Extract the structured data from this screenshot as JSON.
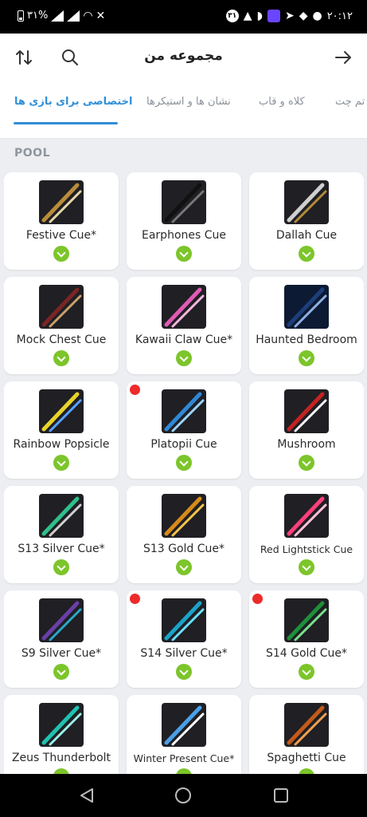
{
  "status_bar": {
    "battery_text": "۳۱%",
    "time": "۲۰:۱۲",
    "notification_count": "۳۱"
  },
  "header": {
    "title": "مجموعه من",
    "sort_icon": "sort-arrows-icon",
    "search_icon": "search-icon",
    "back_icon": "arrow-right-icon"
  },
  "tabs": [
    {
      "label": "اختصاصی برای بازی ها",
      "active": true
    },
    {
      "label": "نشان ها و استیکرها",
      "active": false
    },
    {
      "label": "کلاه و قاب",
      "active": false
    },
    {
      "label": "تم چت",
      "active": false
    }
  ],
  "section": {
    "label": "POOL"
  },
  "items": [
    {
      "name": "Festive Cue*",
      "new": false,
      "thumb_colors": [
        "#1f1f24",
        "#b98c3a",
        "#e7d7a8"
      ]
    },
    {
      "name": "Earphones Cue",
      "new": false,
      "thumb_colors": [
        "#1f1f24",
        "#111111",
        "#777777"
      ]
    },
    {
      "name": "Dallah Cue",
      "new": false,
      "thumb_colors": [
        "#1f1f24",
        "#cfcfcf",
        "#b28a3a"
      ]
    },
    {
      "name": "Mock Chest Cue",
      "new": false,
      "thumb_colors": [
        "#1f1f24",
        "#7a2525",
        "#c9a06a"
      ]
    },
    {
      "name": "Kawaii Claw Cue*",
      "new": false,
      "thumb_colors": [
        "#1f1f24",
        "#e05bb4",
        "#f7b6de"
      ]
    },
    {
      "name": "Haunted Bedroom",
      "new": false,
      "thumb_colors": [
        "#0d1a33",
        "#1d3f7a",
        "#8fb0e0"
      ]
    },
    {
      "name": "Rainbow Popsicle",
      "new": false,
      "thumb_colors": [
        "#1f1f24",
        "#e8d32a",
        "#5aa0ff"
      ]
    },
    {
      "name": "Platopii Cue",
      "new": true,
      "thumb_colors": [
        "#1f1f24",
        "#2f88d6",
        "#9ad4ff"
      ]
    },
    {
      "name": "Mushroom",
      "new": false,
      "thumb_colors": [
        "#1f1f24",
        "#c42222",
        "#f2f2f2"
      ]
    },
    {
      "name": "S13 Silver Cue*",
      "new": false,
      "thumb_colors": [
        "#1f1f24",
        "#2fbf8a",
        "#cfcfcf"
      ]
    },
    {
      "name": "S13 Gold Cue*",
      "new": false,
      "thumb_colors": [
        "#1f1f24",
        "#d88a1a",
        "#f5c44a"
      ]
    },
    {
      "name": "Red Lightstick Cue",
      "new": false,
      "thumb_colors": [
        "#1f1f24",
        "#ff3f7a",
        "#ffc0d8"
      ]
    },
    {
      "name": "S9 Silver Cue*",
      "new": false,
      "thumb_colors": [
        "#1f1f24",
        "#6a3fa8",
        "#2aa8c9"
      ]
    },
    {
      "name": "S14 Silver Cue*",
      "new": true,
      "thumb_colors": [
        "#1f1f24",
        "#1aa3c8",
        "#6ae0ff"
      ]
    },
    {
      "name": "S14 Gold Cue*",
      "new": true,
      "thumb_colors": [
        "#1f1f24",
        "#1f8f3a",
        "#7ae08a"
      ]
    },
    {
      "name": "Zeus Thunderbolt",
      "new": false,
      "thumb_colors": [
        "#1f1f24",
        "#1fc2b0",
        "#9af0e8"
      ]
    },
    {
      "name": "Winter Present Cue*",
      "new": false,
      "thumb_colors": [
        "#1f1f24",
        "#4aa0e8",
        "#ffffff"
      ]
    },
    {
      "name": "Spaghetti Cue",
      "new": false,
      "thumb_colors": [
        "#1f1f24",
        "#c45a1a",
        "#f0a050"
      ]
    }
  ],
  "colors": {
    "accent": "#2f8fd8",
    "owned_check": "#7cc52a",
    "new_dot": "#ee2b2b"
  },
  "navigation_bar": {
    "back_icon": "triangle-back-icon",
    "home_icon": "circle-home-icon",
    "recents_icon": "square-recents-icon"
  }
}
